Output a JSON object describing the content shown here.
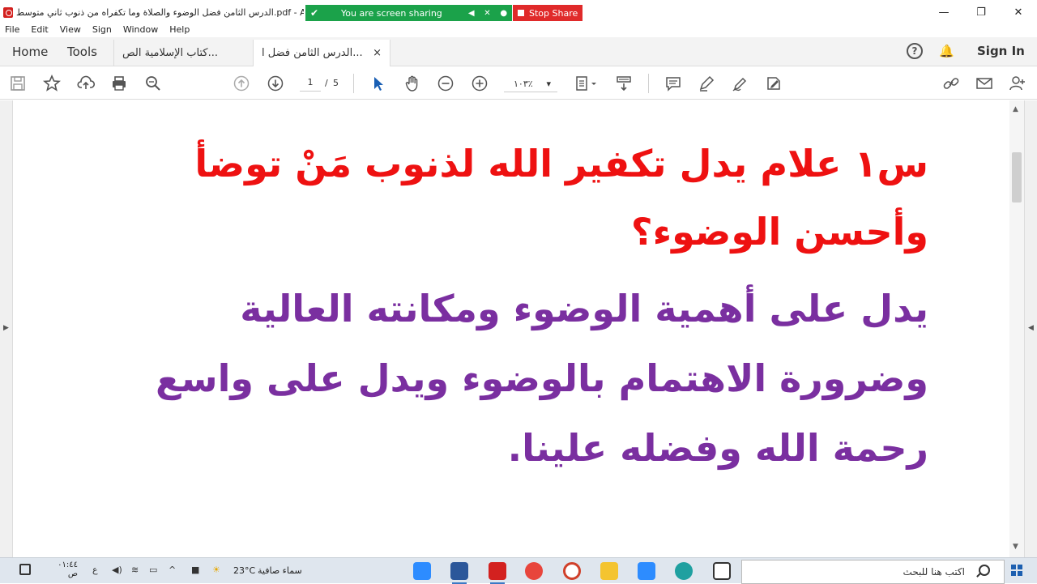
{
  "window": {
    "title": "الدرس الثامن فضل الوضوء والصلاة وما تكفراه من ذنوب ثاني متوسط.pdf - Ad",
    "controls": {
      "minimize": "—",
      "restore": "❐",
      "close": "✕"
    }
  },
  "screen_share": {
    "status_text": "You are screen sharing",
    "stop_label": "Stop Share",
    "color": "#1ba24a",
    "stop_color": "#e02a2a"
  },
  "menu": [
    "File",
    "Edit",
    "View",
    "Sign",
    "Window",
    "Help"
  ],
  "nav": {
    "home": "Home",
    "tools": "Tools",
    "tabs": [
      {
        "label": "كتاب الإسلامية الص...",
        "close": ""
      },
      {
        "label": "الدرس الثامن فضل ا...",
        "close": "×"
      }
    ],
    "help_icon": "?",
    "sign_in": "Sign In"
  },
  "toolbar": {
    "page_current": "1",
    "page_separator": "/",
    "page_total": "5",
    "zoom": "١٠٣٪",
    "zoom_caret": "▾"
  },
  "document": {
    "question": "س١ علام يدل تكفير الله لذنوب مَنْ توضأ وأحسن الوضوء؟",
    "answer": "يدل على أهمية الوضوء ومكانته العالية وضرورة الاهتمام بالوضوء ويدل على واسع رحمة الله وفضله علينا.",
    "question_color": "#ee1111",
    "answer_color": "#7a2fa0"
  },
  "taskbar": {
    "search_placeholder": "اكتب هنا للبحث",
    "clock_time": "٠١:٤٤ ص",
    "temperature": "23°C",
    "weather": "سماء صافية",
    "lang": "ع"
  }
}
